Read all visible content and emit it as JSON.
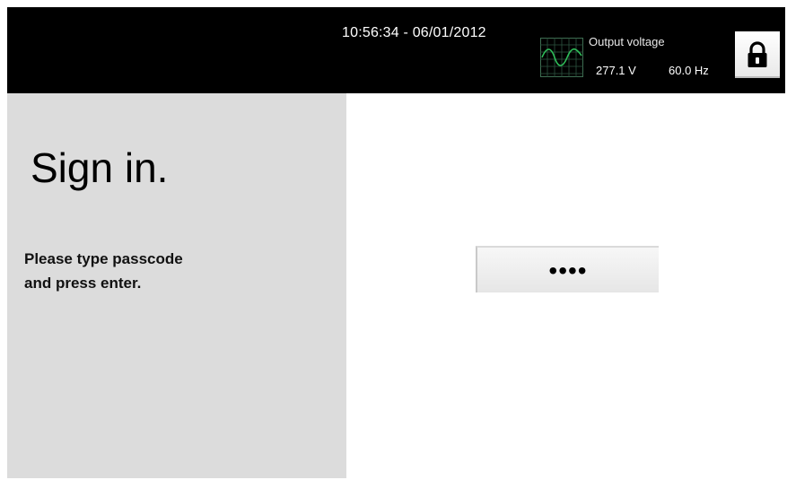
{
  "header": {
    "datetime": "10:56:34 - 06/01/2012",
    "output_voltage": {
      "label": "Output voltage",
      "voltage": "277.1 V",
      "frequency": "60.0 Hz"
    },
    "icons": {
      "waveform": "waveform-icon",
      "lock": "lock-icon"
    }
  },
  "sign_in": {
    "title": "Sign in.",
    "instruction_line1": "Please type passcode",
    "instruction_line2": "and press enter.",
    "passcode_masked": "••••"
  },
  "colors": {
    "topbar": "#000000",
    "left_panel": "#dcdcdc",
    "waveform": "#2fbf5a",
    "scope_grid": "#3e6e52"
  }
}
